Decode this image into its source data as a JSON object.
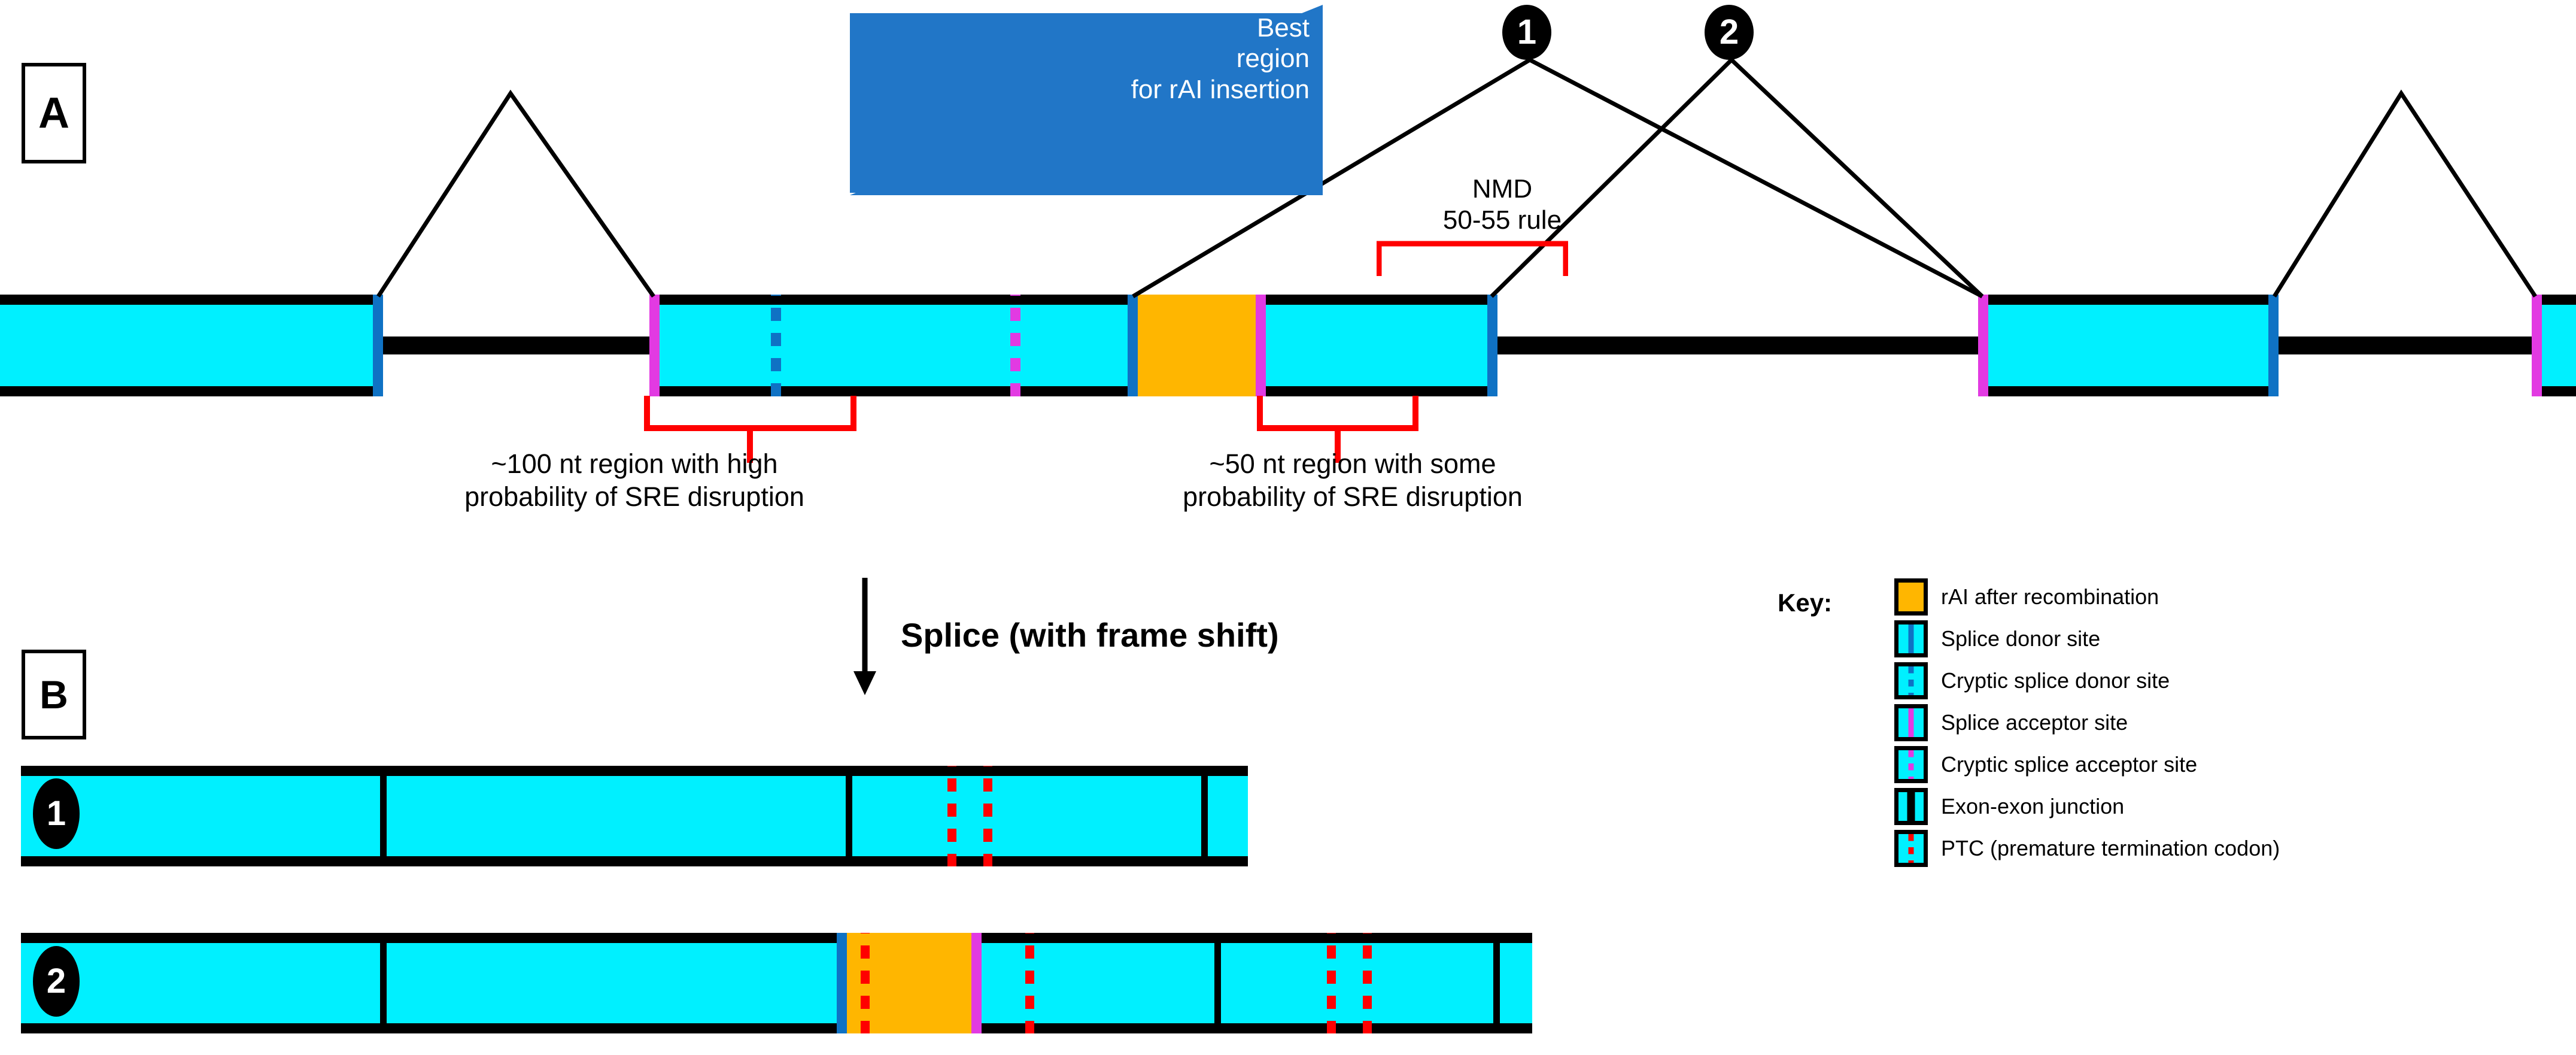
{
  "panels": {
    "a_label": "A",
    "b_label": "B"
  },
  "banner": {
    "line1": "Best",
    "line2": "region",
    "line3": "for rAI insertion"
  },
  "badges": {
    "one": "1",
    "two": "2",
    "transcript_one": "1",
    "transcript_two": "2"
  },
  "nmd": {
    "line1": "NMD",
    "line2": "50-55 rule"
  },
  "captions": {
    "left_line1": "~100 nt region with high",
    "left_line2": "probability of SRE disruption",
    "right_line1": "~50 nt region with some",
    "right_line2": "probability of SRE disruption"
  },
  "splice_arrow": {
    "label": "Splice (with frame shift)"
  },
  "key": {
    "title": "Key:",
    "items": [
      {
        "label": "rAI after recombination",
        "icon": "orange-box-swatch"
      },
      {
        "label": "Splice donor site",
        "icon": "solid-blue-line-swatch"
      },
      {
        "label": "Cryptic splice donor site",
        "icon": "dashed-blue-line-swatch"
      },
      {
        "label": "Splice acceptor site",
        "icon": "solid-magenta-line-swatch"
      },
      {
        "label": "Cryptic splice acceptor site",
        "icon": "dashed-magenta-line-swatch"
      },
      {
        "label": "Exon-exon junction",
        "icon": "black-line-swatch"
      },
      {
        "label": "PTC (premature termination codon)",
        "icon": "dashed-red-line-swatch"
      }
    ]
  },
  "colors": {
    "exon": "#00f0ff",
    "rai": "#ffb600",
    "splice_donor": "#0f72c4",
    "splice_acceptor": "#e23ae2",
    "ptc": "#ff0000",
    "banner": "#2176c7",
    "bracket": "#ff0000",
    "outline": "#000000"
  }
}
